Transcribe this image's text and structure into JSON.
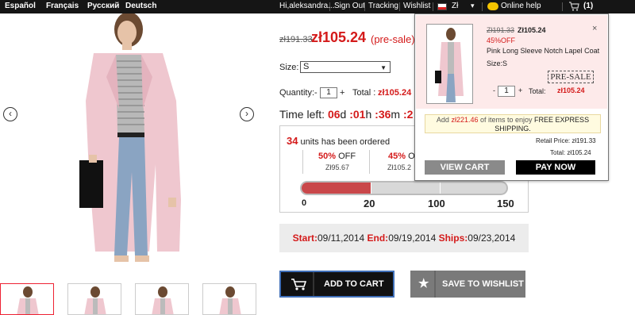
{
  "topbar": {
    "languages": [
      "Español",
      "Français",
      "Русский",
      "Deutsch"
    ],
    "greeting": "Hi,aleksandra...",
    "links": [
      "Sign Out",
      "Tracking",
      "Wishlist"
    ],
    "currency": "Zł",
    "currency_caret": "▾",
    "help": "Online help",
    "cart_count": "(1)"
  },
  "product": {
    "old_price": "zł191.33",
    "price": "zł105.24",
    "presale_label": "(pre-sale)",
    "size_label": "Size:",
    "size_value": "S",
    "quantity_label": "Quantity:",
    "qty_minus": "-",
    "qty_value": "1",
    "qty_plus": "+",
    "total_label": "Total :",
    "total_value": "zł105.24",
    "time_left_label": "Time left:",
    "time_days": "06",
    "d_unit": "d",
    "time_hours": "01",
    "h_unit": "h",
    "time_mins": "36",
    "m_unit": "m",
    "time_secs": "2",
    "time_colon": ":",
    "ordered_count": "34",
    "ordered_text": "units has been ordered",
    "tier1_pct": "50%",
    "tier1_off": "OFF",
    "tier1_price": "Zł95.67",
    "tier2_pct": "45%",
    "tier2_off": "O",
    "tier2_price": "Zł105.2",
    "progress_fraction": 0.34,
    "progress_labels": [
      "0",
      "20",
      "100",
      "150"
    ],
    "start_label": "Start:",
    "start_date": "09/11,2014",
    "end_label": "End:",
    "end_date": "09/19,2014",
    "ships_label": "Ships:",
    "ships_date": "09/23,2014",
    "add_to_cart": "ADD TO CART",
    "save_to_wishlist": "SAVE TO WISHLIST"
  },
  "cart_popup": {
    "old_price": "Zł191.33",
    "price": "Zł105.24",
    "discount": "45%OFF",
    "name": "Pink Long Sleeve Notch Lapel Coat",
    "size_label": "Size:",
    "size": "S",
    "stamp": "PRE-SALE",
    "close": "×",
    "qty_minus": "-",
    "qty": "1",
    "qty_plus": "+",
    "total_label": "Total:",
    "total": "zł105.24",
    "express_add": "Add",
    "express_amount": "zł221.46",
    "express_mid": "of items to enjoy",
    "express_strong": "FREE EXPRESS SHIPPING.",
    "retail_label": "Retail Price:",
    "retail_value": "zł191.33",
    "sum_label": "Total:",
    "sum_value": "zł105.24",
    "view_cart": "VIEW CART",
    "pay_now": "PAY NOW"
  },
  "colors": {
    "accent_red": "#d41a1a",
    "topbar": "#151515",
    "coat_pink": "#efc7cf"
  }
}
